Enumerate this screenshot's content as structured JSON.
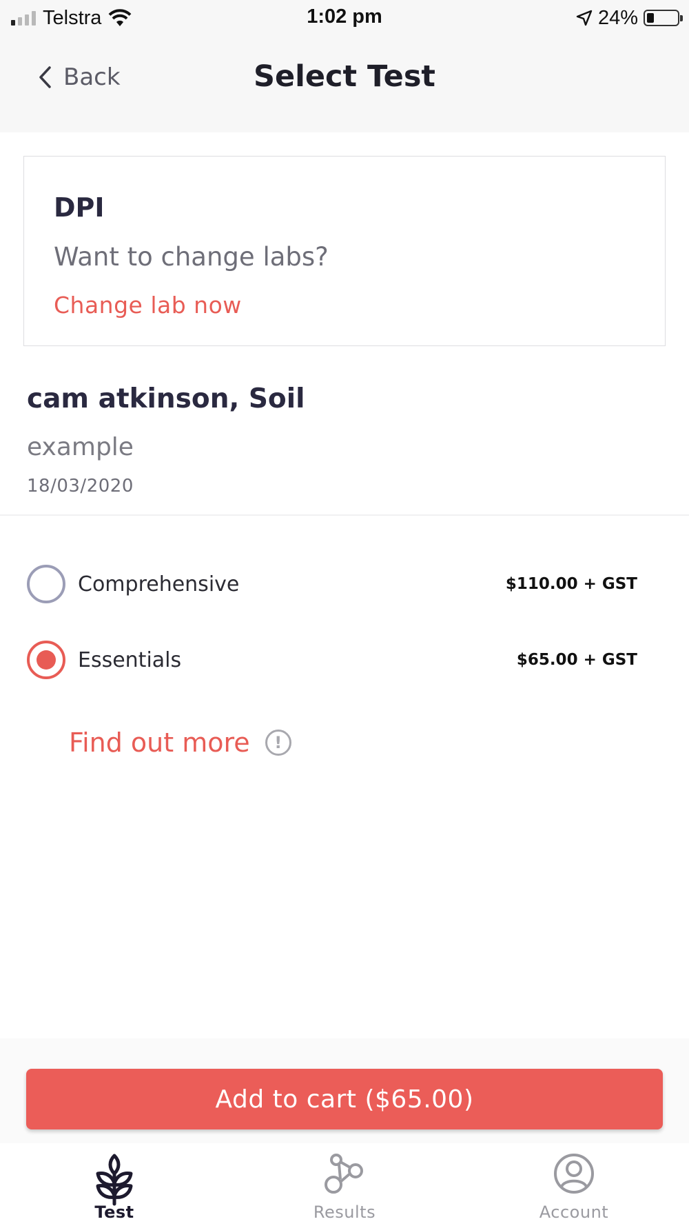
{
  "status": {
    "carrier": "Telstra",
    "time": "1:02 pm",
    "battery_percent": "24%",
    "battery_level": 0.24
  },
  "nav": {
    "back_label": "Back",
    "title": "Select Test"
  },
  "lab": {
    "name": "DPI",
    "question": "Want to change labs?",
    "change_link": "Change lab now"
  },
  "sample": {
    "title": "cam atkinson, Soil",
    "subtitle": "example",
    "date": "18/03/2020"
  },
  "options": [
    {
      "label": "Comprehensive",
      "price": "$110.00 + GST",
      "selected": false
    },
    {
      "label": "Essentials",
      "price": "$65.00 + GST",
      "selected": true
    }
  ],
  "find_more": {
    "label": "Find out more",
    "icon": "info-circle-icon"
  },
  "cart": {
    "label": "Add to cart ($65.00)"
  },
  "tabs": [
    {
      "label": "Test",
      "icon": "wheat-icon",
      "active": true
    },
    {
      "label": "Results",
      "icon": "molecule-icon",
      "active": false
    },
    {
      "label": "Account",
      "icon": "user-circle-icon",
      "active": false
    }
  ],
  "colors": {
    "accent": "#e85c55",
    "button": "#eb5d58",
    "radio_inactive": "#9b9db6",
    "text_dark": "#2a2940"
  }
}
